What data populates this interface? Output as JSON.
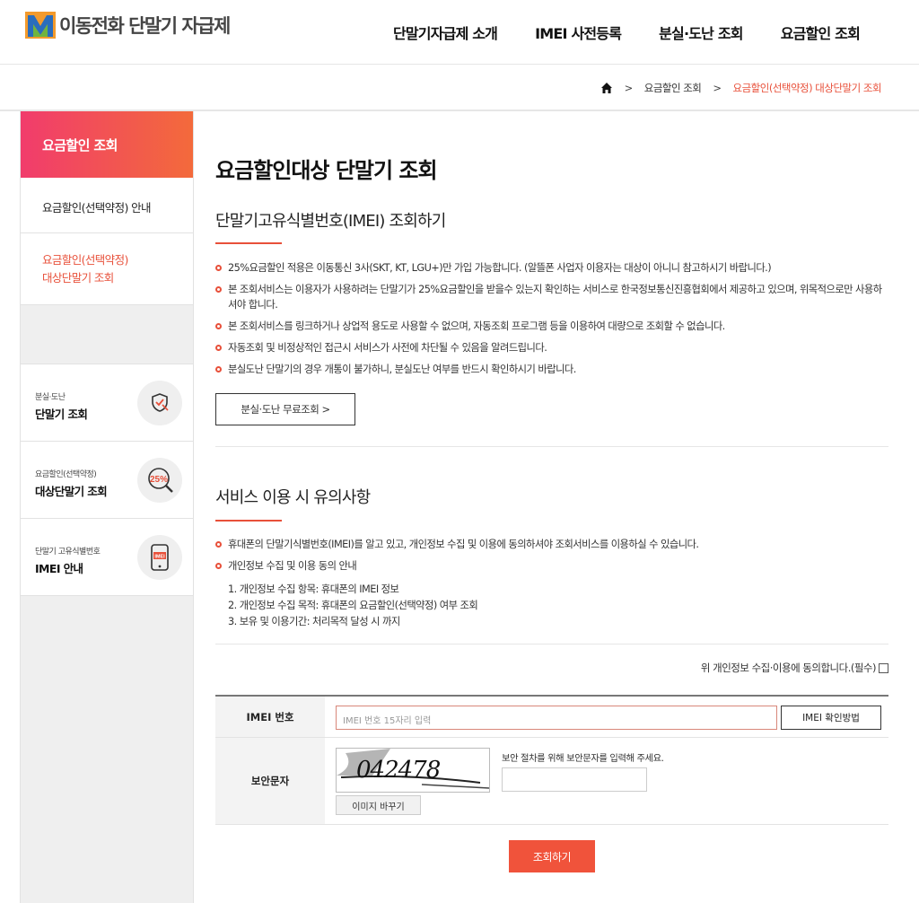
{
  "header": {
    "logo_text": "이동전화 단말기 자급제",
    "nav": [
      "단말기자급제 소개",
      "IMEI 사전등록",
      "분실·도난 조회",
      "요금할인 조회"
    ]
  },
  "breadcrumb": {
    "home_icon": "home-icon",
    "sep": ">",
    "level1": "요금할인 조회",
    "current": "요금할인(선택약정) 대상단말기 조회"
  },
  "sidebar": {
    "title": "요금할인 조회",
    "items": [
      {
        "label": "요금할인(선택약정) 안내"
      },
      {
        "line1": "요금할인(선택약정)",
        "line2": "대상단말기 조회"
      }
    ],
    "quick": [
      {
        "small": "분실·도난",
        "big": "단말기 조회",
        "icon": "shield-icon"
      },
      {
        "small": "요금할인(선택약정)",
        "big": "대상단말기 조회",
        "icon": "magnifier-25-icon",
        "icon_text": "25%"
      },
      {
        "small": "단말기 고유식별번호",
        "big": "IMEI 안내",
        "icon": "phone-imei-icon",
        "icon_text": "IMEI"
      }
    ]
  },
  "main": {
    "title": "요금할인대상 단말기 조회",
    "section1": {
      "title": "단말기고유식별번호(IMEI) 조회하기",
      "bullets": [
        "25%요금할인 적용은 이동통신 3사(SKT, KT, LGU+)만 가입 가능합니다. (알뜰폰 사업자 이용자는 대상이 아니니 참고하시기 바랍니다.)",
        "본 조회서비스는 이용자가 사용하려는 단말기가 25%요금할인을 받을수 있는지 확인하는 서비스로 한국정보통신진흥협회에서 제공하고 있으며, 위목적으로만 사용하셔야 합니다.",
        "본 조회서비스를 링크하거나 상업적 용도로 사용할 수 없으며, 자동조회 프로그램 등을 이용하여 대량으로 조회할 수 없습니다.",
        "자동조회 및 비정상적인 접근시 서비스가 사전에 차단될 수 있음을 알려드립니다.",
        "분실도난 단말기의 경우 개통이 불가하니, 분실도난 여부를 반드시 확인하시기 바랍니다."
      ],
      "button": "분실·도난 무료조회 >"
    },
    "section2": {
      "title": "서비스 이용 시 유의사항",
      "bullets": [
        "휴대폰의 단말기식별번호(IMEI)를 알고 있고, 개인정보 수집 및 이용에 동의하셔야 조회서비스를 이용하실 수 있습니다.",
        "개인정보 수집 및 이용 동의 안내"
      ],
      "list": [
        "1. 개인정보 수집 항목: 휴대폰의 IMEI 정보",
        "2. 개인정보 수집 목적: 휴대폰의 요금할인(선택약정) 여부 조회",
        "3. 보유 및 이용기간: 처리목적 달성 시 까지"
      ],
      "agree_label": "위 개인정보 수집·이용에 동의합니다.(필수)"
    },
    "form": {
      "imei_label": "IMEI 번호",
      "imei_placeholder": "IMEI 번호 15자리 입력",
      "imei_help_button": "IMEI 확인방법",
      "captcha_label": "보안문자",
      "captcha_text": "042478",
      "captcha_refresh": "이미지 바꾸기",
      "captcha_hint": "보안 절차를 위해 보안문자를 입력해 주세요.",
      "submit": "조회하기"
    }
  },
  "colors": {
    "accent": "#e8503a",
    "gradient_start": "#f13c6c",
    "gradient_end": "#f36a3b",
    "submit_bg": "#f0533b"
  }
}
